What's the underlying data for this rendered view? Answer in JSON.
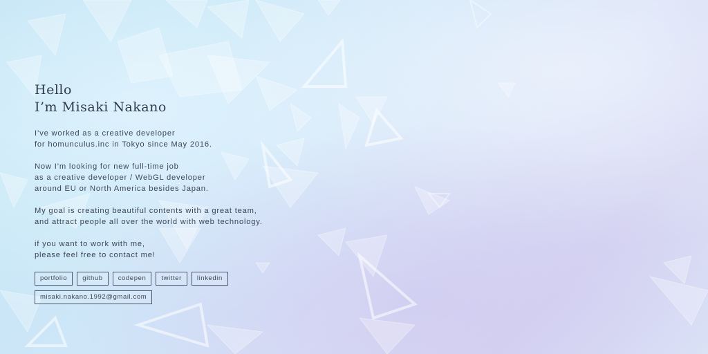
{
  "heading": {
    "line1": "Hello",
    "line2": "I’m Misaki Nakano"
  },
  "paragraphs": [
    [
      "I’ve worked as a creative developer",
      "for homunculus.inc in Tokyo since May 2016."
    ],
    [
      "Now I’m looking for new full-time job",
      "as a creative developer / WebGL developer",
      "around EU or North America besides Japan."
    ],
    [
      "My goal is creating beautiful contents with a great team,",
      "and attract people all over the world with web technology."
    ],
    [
      "if you want to work with me,",
      "please feel free to contact me!"
    ]
  ],
  "links": {
    "portfolio": "portfolio",
    "github": "github",
    "codepen": "codepen",
    "twitter": "twitter",
    "linkedin": "linkedin",
    "email": "misaki.nakano.1992@gmail.com"
  },
  "colors": {
    "text": "#3b4658",
    "border": "#48526a"
  }
}
